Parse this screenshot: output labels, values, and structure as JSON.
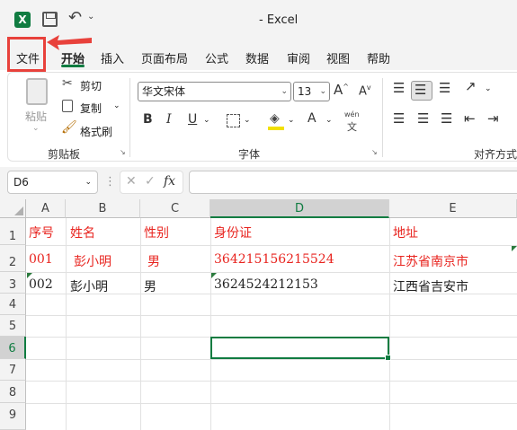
{
  "window": {
    "title": "-  Excel",
    "logo": "X"
  },
  "qat": {
    "save_icon": "save-icon",
    "undo_glyph": "↶",
    "more_glyph": "⌄"
  },
  "tabs": [
    {
      "label": "文件"
    },
    {
      "label": "开始",
      "active": true
    },
    {
      "label": "插入"
    },
    {
      "label": "页面布局"
    },
    {
      "label": "公式"
    },
    {
      "label": "数据"
    },
    {
      "label": "审阅"
    },
    {
      "label": "视图"
    },
    {
      "label": "帮助"
    }
  ],
  "ribbon": {
    "clipboard": {
      "paste": "粘贴",
      "cut": "剪切",
      "copy": "复制",
      "format_painter": "格式刷",
      "label": "剪贴板"
    },
    "font": {
      "font_name": "华文宋体",
      "font_size": "13",
      "grow": "A",
      "shrink": "A",
      "bold": "B",
      "italic": "I",
      "underline": "U",
      "fontcolor": "A",
      "phonetic_top": "wén",
      "phonetic_bottom": "文",
      "label": "字体"
    },
    "alignment": {
      "label": "对齐方式"
    }
  },
  "formula_bar": {
    "name_box": "D6",
    "fx": "fx",
    "value": ""
  },
  "columns": [
    "A",
    "B",
    "C",
    "D",
    "E"
  ],
  "rows": [
    "1",
    "2",
    "3",
    "4",
    "5",
    "6",
    "7",
    "8",
    "9"
  ],
  "cells": {
    "r1": {
      "a": "序号",
      "b": "姓名",
      "c": "性别",
      "d": "身份证",
      "e": "地址"
    },
    "r2": {
      "a": "001",
      "b": "彭小明",
      "c": "男",
      "d": "364215156215524",
      "e": "江苏省南京市"
    },
    "r3": {
      "a": "002",
      "b": "彭小明",
      "c": "男",
      "d": "3624524212153",
      "e": "江西省吉安市"
    }
  },
  "selected_cell": "D6",
  "colors": {
    "accent": "#107c41",
    "highlight_red": "#e8241f",
    "annotation_red": "#e8413b"
  }
}
